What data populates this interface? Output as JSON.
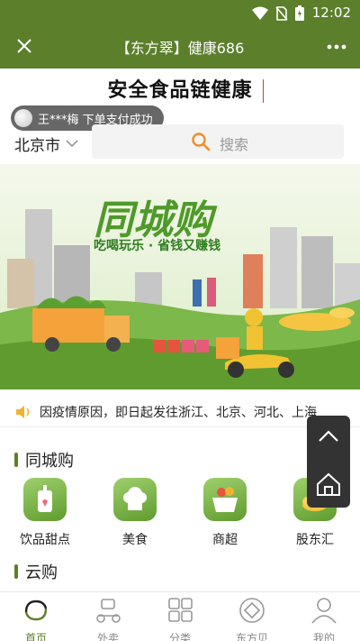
{
  "status_bar": {
    "time": "12:02"
  },
  "header": {
    "title": "【东方翠】健康686"
  },
  "slogan": {
    "text": "安全食品链健康"
  },
  "order_toast": {
    "text": "王***梅 下单支付成功"
  },
  "location": {
    "city": "北京市"
  },
  "search": {
    "placeholder": "搜索"
  },
  "banner": {
    "title": "同城购",
    "subtitle": "吃喝玩乐 · 省钱又赚钱"
  },
  "notice": {
    "text": "因疫情原因，即日起发往浙江、北京、河北、上海"
  },
  "sections": {
    "local": {
      "title": "同城购"
    },
    "cloud": {
      "title": "云购"
    }
  },
  "categories": [
    {
      "label": "饮品甜点",
      "icon": "drink-cup-icon"
    },
    {
      "label": "美食",
      "icon": "chef-hat-icon"
    },
    {
      "label": "商超",
      "icon": "supermarket-basket-icon"
    },
    {
      "label": "股东汇",
      "icon": "coin-icon"
    }
  ],
  "tabs": [
    {
      "label": "首页",
      "icon": "home-icon",
      "active": true
    },
    {
      "label": "外卖",
      "icon": "scooter-icon",
      "active": false
    },
    {
      "label": "分类",
      "icon": "grid-icon",
      "active": false
    },
    {
      "label": "东方贝",
      "icon": "diamond-coin-icon",
      "active": false
    },
    {
      "label": "我的",
      "icon": "person-icon",
      "active": false
    }
  ],
  "colors": {
    "brand_green": "#5c7f2c",
    "accent_orange": "#f08c2b",
    "active_tab": "#5c7f2c"
  }
}
